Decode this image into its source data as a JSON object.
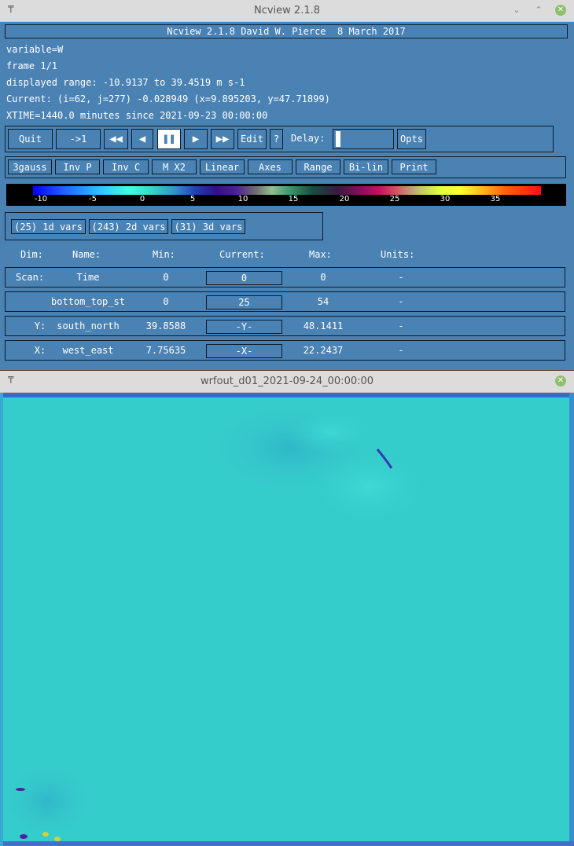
{
  "ctrl_window": {
    "title": "Ncview 2.1.8",
    "header": "Ncview 2.1.8 David W. Pierce  8 March 2017",
    "info": [
      "variable=W",
      "frame 1/1",
      "displayed range: -10.9137 to 39.4519 m s-1",
      "Current: (i=62, j=277) -0.028949 (x=9.895203, y=47.71899)",
      "XTIME=1440.0 minutes since 2021-09-23 00:00:00"
    ],
    "controls": {
      "quit": "Quit",
      "to_one": "->1",
      "rewind": "◀◀",
      "back": "◀",
      "pause": "❚❚",
      "forward": "▶",
      "fast_forward": "▶▶",
      "edit": "Edit",
      "help": "?",
      "delay_label": "Delay:",
      "opts": "Opts"
    },
    "options": [
      "3gauss",
      "Inv P",
      "Inv C",
      "M X2",
      "Linear",
      "Axes",
      "Range",
      "Bi-lin",
      "Print"
    ],
    "colorbar": {
      "labels": [
        "-10",
        "-5",
        "0",
        "5",
        "10",
        "15",
        "20",
        "25",
        "30",
        "35"
      ]
    },
    "var_buttons": [
      "(25) 1d vars",
      "(243) 2d vars",
      "(31) 3d vars"
    ],
    "dim_headers": {
      "dim": "Dim:",
      "name": "Name:",
      "min": "Min:",
      "current": "Current:",
      "max": "Max:",
      "units": "Units:"
    },
    "dim_rows": [
      {
        "dim": "Scan:",
        "name": "Time",
        "min": "0",
        "current": "0",
        "max": "0",
        "units": "-"
      },
      {
        "dim": "",
        "name": "bottom_top_st",
        "min": "0",
        "current": "25",
        "max": "54",
        "units": "-"
      },
      {
        "dim": "Y:",
        "name": "south_north",
        "min": "39.8588",
        "current": "-Y-",
        "max": "48.1411",
        "units": "-"
      },
      {
        "dim": "X:",
        "name": "west_east",
        "min": "7.75635",
        "current": "-X-",
        "max": "22.2437",
        "units": "-"
      }
    ]
  },
  "image_window": {
    "title": "wrfout_d01_2021-09-24_00:00:00"
  }
}
